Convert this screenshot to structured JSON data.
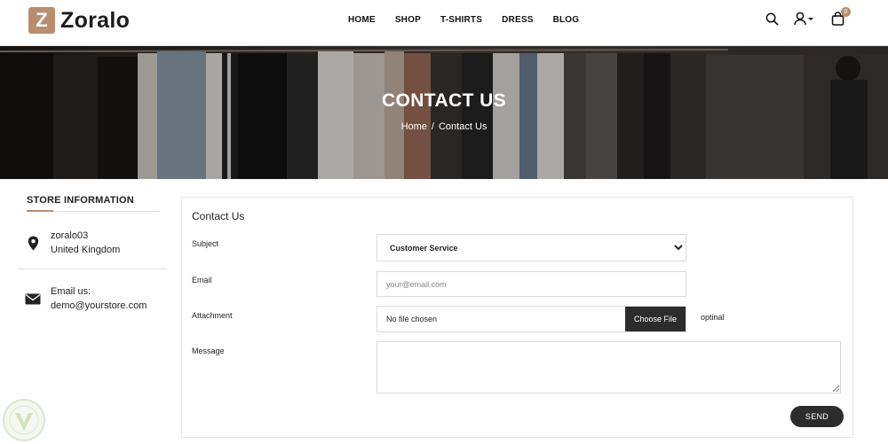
{
  "brand": {
    "logo_letter": "Z",
    "name": "Zoralo",
    "accent": "#b98e6f"
  },
  "nav": {
    "items": [
      "HOME",
      "SHOP",
      "T-SHIRTS",
      "DRESS",
      "BLOG"
    ]
  },
  "header_icons": {
    "search": "search-icon",
    "account": "user-icon",
    "cart": "cart-icon",
    "cart_count": "0"
  },
  "banner": {
    "title": "CONTACT US",
    "breadcrumb_home": "Home",
    "breadcrumb_sep": "/",
    "breadcrumb_current": "Contact Us"
  },
  "sidebar": {
    "title": "STORE INFORMATION",
    "address_line1": "zoralo03",
    "address_line2": "United Kingdom",
    "email_label": "Email us:",
    "email_value": "demo@yourstore.com"
  },
  "form": {
    "title": "Contact Us",
    "subject_label": "Subject",
    "subject_value": "Customer Service",
    "email_label": "Email",
    "email_placeholder": "your@email.com",
    "attachment_label": "Attachment",
    "file_status": "No file chosen",
    "choose_file_label": "Choose File",
    "optional_label": "optinal",
    "message_label": "Message",
    "send_label": "SEND"
  }
}
